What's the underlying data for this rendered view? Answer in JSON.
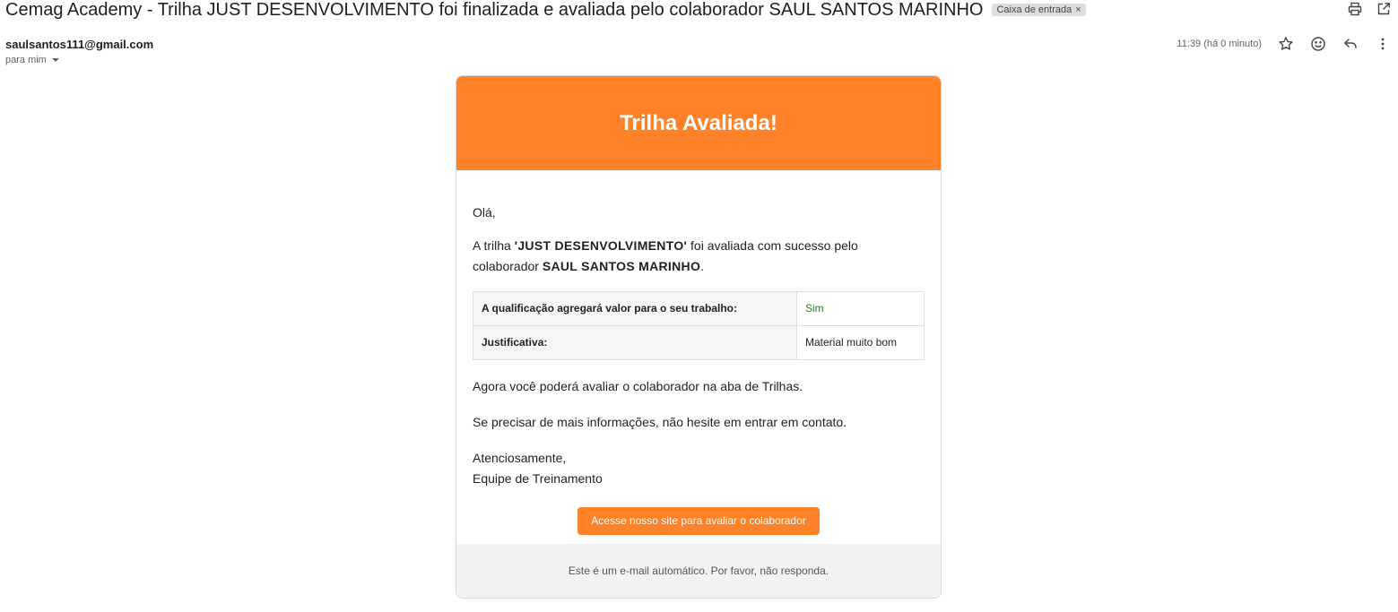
{
  "email": {
    "subject": "Cemag Academy - Trilha JUST DESENVOLVIMENTO foi finalizada e avaliada pelo colaborador SAUL SANTOS MARINHO",
    "label": "Caixa de entrada",
    "label_close": "×",
    "sender": "saulsantos111@gmail.com",
    "recipient": "para mim",
    "time": "11:39 (há 0 minuto)"
  },
  "message": {
    "header_title": "Trilha Avaliada!",
    "greeting": "Olá,",
    "intro_pre": "A trilha ",
    "trail_name": "'JUST DESENVOLVIMENTO'",
    "intro_mid": " foi avaliada com sucesso pelo colaborador ",
    "collaborator": "SAUL SANTOS MARINHO",
    "intro_end": ".",
    "table": [
      {
        "question": "A qualificação agregará valor para o seu trabalho:",
        "answer": "Sim"
      },
      {
        "question": "Justificativa:",
        "answer": "Material muito bom"
      }
    ],
    "line1": "Agora você poderá avaliar o colaborador na aba de Trilhas.",
    "line2": "Se precisar de mais informações, não hesite em entrar em contato.",
    "sign1": "Atenciosamente,",
    "sign2": "Equipe de Treinamento",
    "cta_label": "Acesse nosso site para avaliar o colaborador",
    "footer": "Este é um e-mail automático. Por favor, não responda."
  },
  "icons": {
    "print": "print-icon",
    "open_new": "open-in-new-window-icon",
    "star": "star-icon",
    "emoji": "emoji-reaction-icon",
    "reply": "reply-icon",
    "more": "more-options-icon"
  },
  "colors": {
    "accent": "#ff8128",
    "answer_yes": "#1a8a1a"
  }
}
